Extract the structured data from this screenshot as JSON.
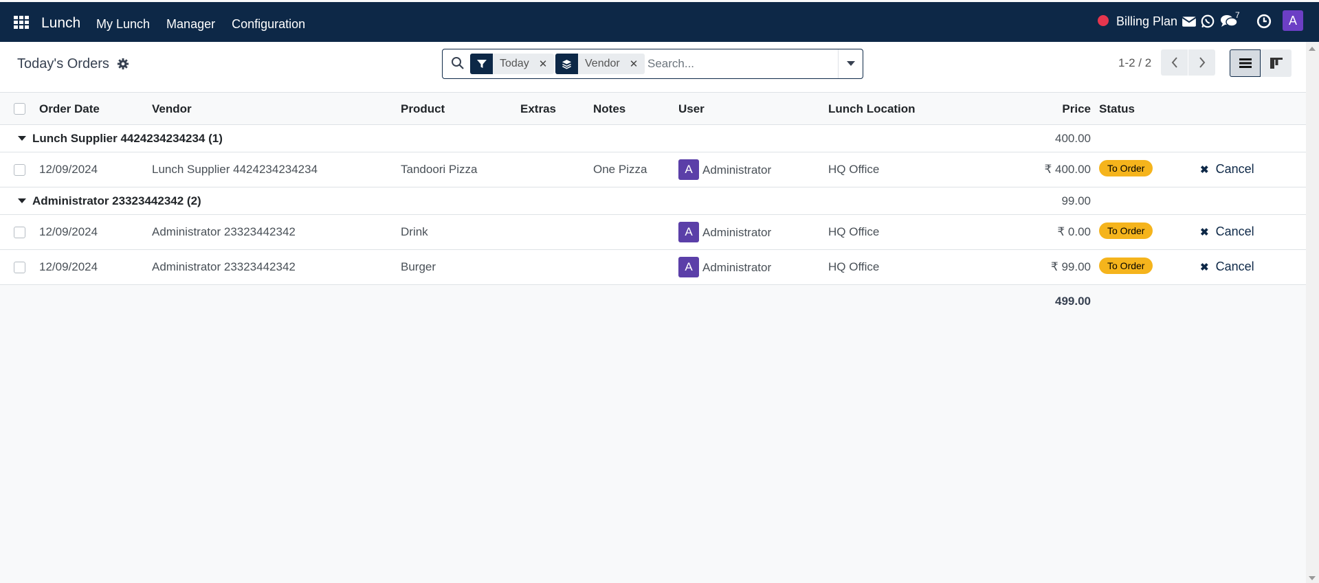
{
  "navbar": {
    "brand": "Lunch",
    "menu": [
      "My Lunch",
      "Manager",
      "Configuration"
    ],
    "billing_plan": "Billing Plan",
    "chat_count": "7",
    "avatar_letter": "A"
  },
  "control_panel": {
    "title": "Today's Orders",
    "facets": [
      {
        "label": "Today",
        "icon": "filter-icon"
      },
      {
        "label": "Vendor",
        "icon": "layers-icon"
      }
    ],
    "search_placeholder": "Search...",
    "pager": "1-2 / 2"
  },
  "table": {
    "columns": [
      "Order Date",
      "Vendor",
      "Product",
      "Extras",
      "Notes",
      "User",
      "Lunch Location",
      "Price",
      "Status"
    ],
    "groups": [
      {
        "label": "Lunch Supplier 4424234234234 (1)",
        "total": "400.00",
        "rows": [
          {
            "date": "12/09/2024",
            "vendor": "Lunch Supplier 4424234234234",
            "product": "Tandoori Pizza",
            "extras": "",
            "notes": "One Pizza",
            "user": "Administrator",
            "user_initial": "A",
            "location": "HQ Office",
            "price": "₹ 400.00",
            "status": "To Order",
            "action": "Cancel"
          }
        ]
      },
      {
        "label": "Administrator 23323442342 (2)",
        "total": "99.00",
        "rows": [
          {
            "date": "12/09/2024",
            "vendor": "Administrator 23323442342",
            "product": "Drink",
            "extras": "",
            "notes": "",
            "user": "Administrator",
            "user_initial": "A",
            "location": "HQ Office",
            "price": "₹ 0.00",
            "status": "To Order",
            "action": "Cancel"
          },
          {
            "date": "12/09/2024",
            "vendor": "Administrator 23323442342",
            "product": "Burger",
            "extras": "",
            "notes": "",
            "user": "Administrator",
            "user_initial": "A",
            "location": "HQ Office",
            "price": "₹ 99.00",
            "status": "To Order",
            "action": "Cancel"
          }
        ]
      }
    ],
    "grand_total": "499.00"
  },
  "colors": {
    "navbar_bg": "#0d2847",
    "status_badge": "#f5b41c",
    "avatar": "#6c3fc5",
    "red_dot": "#e5364e"
  }
}
